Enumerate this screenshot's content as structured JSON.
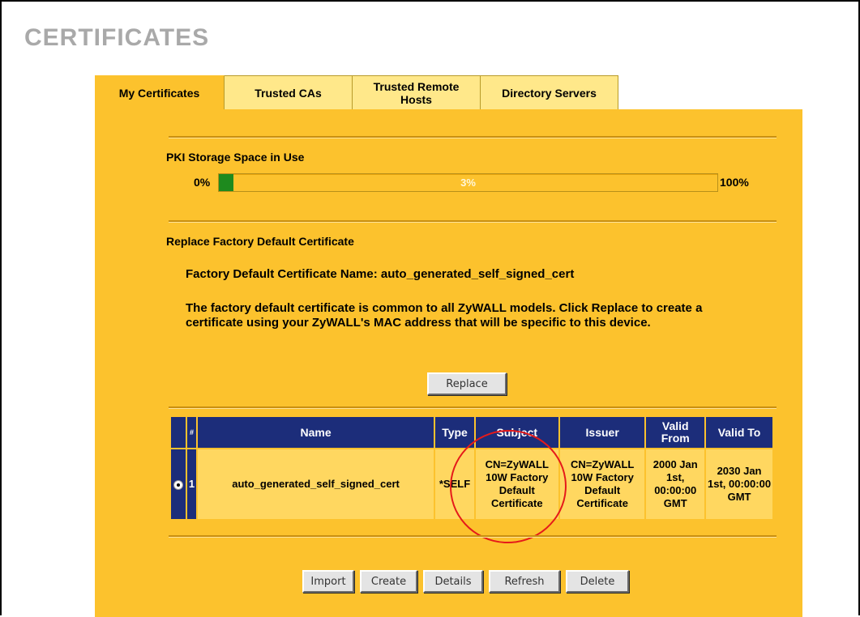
{
  "page_title": "CERTIFICATES",
  "tabs": [
    {
      "label": "My Certificates"
    },
    {
      "label": "Trusted CAs"
    },
    {
      "label": "Trusted Remote Hosts"
    },
    {
      "label": "Directory Servers"
    }
  ],
  "storage": {
    "heading": "PKI Storage Space in Use",
    "min_label": "0%",
    "max_label": "100%",
    "percent_text": "3%",
    "percent_value": 3
  },
  "replace": {
    "heading": "Replace Factory Default Certificate",
    "name_line": "Factory Default Certificate Name: auto_generated_self_signed_cert",
    "description": "The factory default certificate is common to all ZyWALL models. Click Replace to create a certificate using your ZyWALL's MAC address that will be specific to this device.",
    "button": "Replace"
  },
  "table": {
    "headers": [
      "",
      "#",
      "Name",
      "Type",
      "Subject",
      "Issuer",
      "Valid From",
      "Valid To"
    ],
    "rows": [
      {
        "index": "1",
        "name": "auto_generated_self_signed_cert",
        "type": "*SELF",
        "subject": "CN=ZyWALL 10W Factory Default Certificate",
        "issuer": "CN=ZyWALL 10W Factory Default Certificate",
        "valid_from": "2000 Jan 1st, 00:00:00 GMT",
        "valid_to": "2030 Jan 1st, 00:00:00 GMT"
      }
    ]
  },
  "buttons": {
    "import": "Import",
    "create": "Create",
    "details": "Details",
    "refresh": "Refresh",
    "delete": "Delete"
  },
  "colors": {
    "panel": "#fcc22d",
    "tab_inactive": "#ffe88a",
    "table_header": "#1c2d7a",
    "progress_fill": "#1e8a1e",
    "annotation": "#e51a1a"
  }
}
